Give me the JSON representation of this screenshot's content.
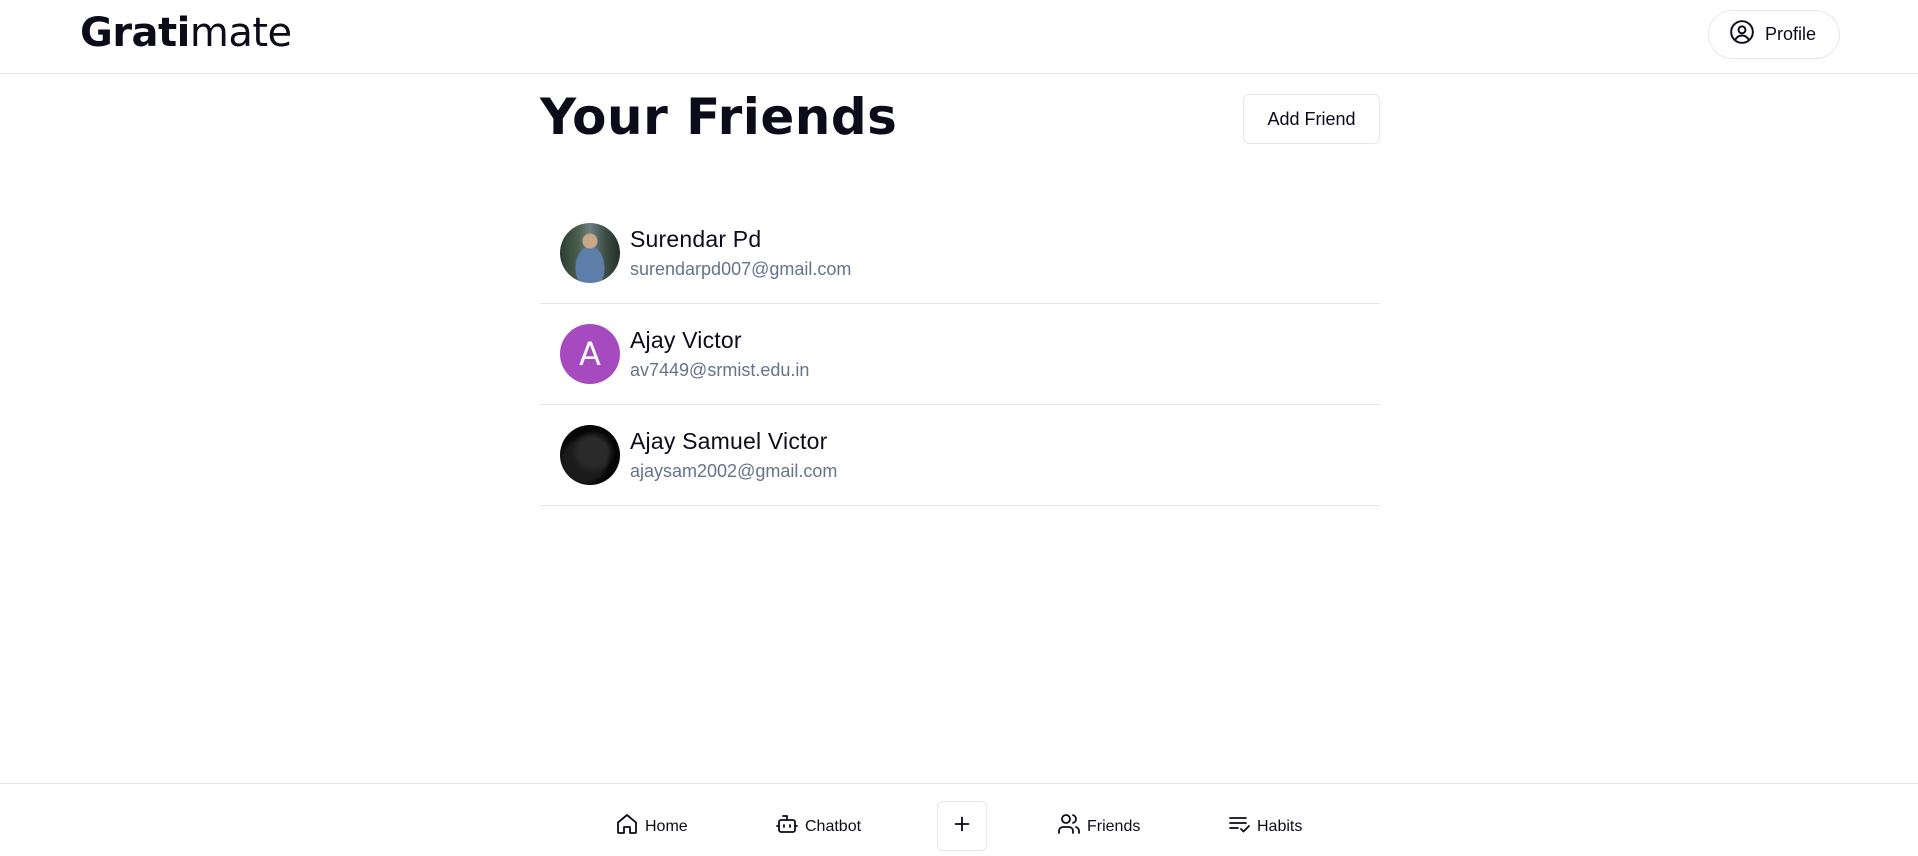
{
  "header": {
    "logo_bold": "Grati",
    "logo_light": "mate",
    "profile_label": "Profile"
  },
  "main": {
    "title": "Your Friends",
    "add_friend_label": "Add Friend",
    "friends": [
      {
        "name": "Surendar Pd",
        "email": "surendarpd007@gmail.com",
        "avatar": "photo"
      },
      {
        "name": "Ajay Victor",
        "email": "av7449@srmist.edu.in",
        "avatar_letter": "A",
        "avatar_color": "#a64ac0"
      },
      {
        "name": "Ajay Samuel Victor",
        "email": "ajaysam2002@gmail.com",
        "avatar": "photo"
      }
    ]
  },
  "bottom_nav": {
    "home": "Home",
    "chatbot": "Chatbot",
    "friends": "Friends",
    "habits": "Habits"
  },
  "colors": {
    "border": "#e5e7eb",
    "text": "#0b0b1a",
    "muted": "#64748b"
  }
}
